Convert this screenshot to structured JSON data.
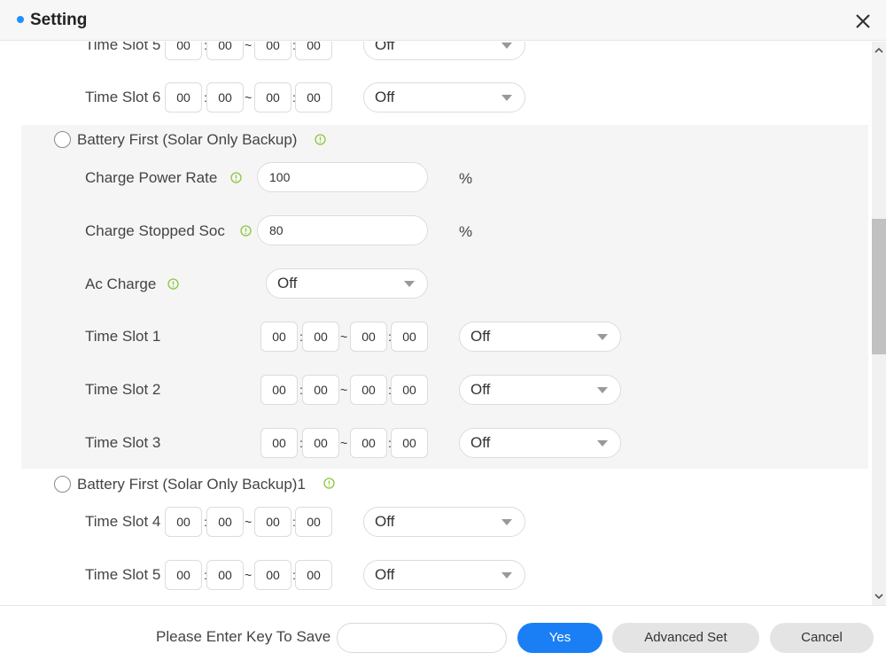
{
  "dialog": {
    "title": "Setting"
  },
  "top_slots": [
    {
      "label": "Time Slot 5",
      "start_h": "00",
      "start_m": "00",
      "end_h": "00",
      "end_m": "00",
      "state": "Off"
    },
    {
      "label": "Time Slot 6",
      "start_h": "00",
      "start_m": "00",
      "end_h": "00",
      "end_m": "00",
      "state": "Off"
    }
  ],
  "mode_a": {
    "label": "Battery First (Solar Only Backup)",
    "charge_power_rate": {
      "label": "Charge Power Rate",
      "value": "100",
      "unit": "%"
    },
    "charge_stopped_soc": {
      "label": "Charge Stopped Soc",
      "value": "80",
      "unit": "%"
    },
    "ac_charge": {
      "label": "Ac Charge",
      "value": "Off"
    },
    "slots": [
      {
        "label": "Time Slot 1",
        "start_h": "00",
        "start_m": "00",
        "end_h": "00",
        "end_m": "00",
        "state": "Off"
      },
      {
        "label": "Time Slot 2",
        "start_h": "00",
        "start_m": "00",
        "end_h": "00",
        "end_m": "00",
        "state": "Off"
      },
      {
        "label": "Time Slot 3",
        "start_h": "00",
        "start_m": "00",
        "end_h": "00",
        "end_m": "00",
        "state": "Off"
      }
    ]
  },
  "mode_b": {
    "label": "Battery First (Solar Only Backup)1",
    "slots": [
      {
        "label": "Time Slot 4",
        "start_h": "00",
        "start_m": "00",
        "end_h": "00",
        "end_m": "00",
        "state": "Off"
      },
      {
        "label": "Time Slot 5",
        "start_h": "00",
        "start_m": "00",
        "end_h": "00",
        "end_m": "00",
        "state": "Off"
      }
    ]
  },
  "separators": {
    "colon": ":",
    "tilde": "~"
  },
  "footer": {
    "key_label": "Please Enter Key To Save",
    "key_value": "",
    "yes_label": "Yes",
    "advanced_label": "Advanced Set",
    "cancel_label": "Cancel"
  },
  "colors": {
    "accent": "#1a7ff5",
    "info_icon": "#8dc63f",
    "section_bg": "#f5f5f5"
  }
}
